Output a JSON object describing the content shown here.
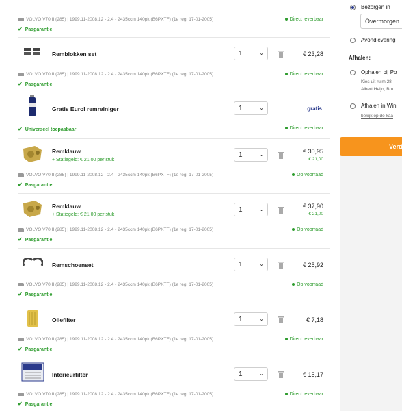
{
  "vehicle_text": "VOLVO V70 II (285) | 1999.11-2008.12 - 2.4 - 2435ccm 140pk (B6PXTF) (1e reg: 17-01-2005)",
  "guarantee_label": "Pasgarantie",
  "universal_label": "Universeel toepasbaar",
  "items": [
    {
      "name": "",
      "qty": "",
      "price": "",
      "stock": "Direct leverbaar"
    },
    {
      "name": "Remblokken set",
      "qty": "1",
      "price": "€ 23,28",
      "stock": "Direct leverbaar"
    },
    {
      "name": "Gratis Eurol remreiniger",
      "qty": "1",
      "price": "gratis",
      "stock": "Direct leverbaar"
    },
    {
      "name": "Remklauw",
      "statiegeld": "+ Statiegeld: € 21,00 per stuk",
      "qty": "1",
      "price": "€ 30,95",
      "deposit": "€ 21,00",
      "stock": "Op voorraad"
    },
    {
      "name": "Remklauw",
      "statiegeld": "+ Statiegeld: € 21,00 per stuk",
      "qty": "1",
      "price": "€ 37,90",
      "deposit": "€ 21,00",
      "stock": "Op voorraad"
    },
    {
      "name": "Remschoenset",
      "qty": "1",
      "price": "€ 25,92",
      "stock": "Op voorraad"
    },
    {
      "name": "Oliefilter",
      "qty": "1",
      "price": "€ 7,18",
      "stock": "Direct leverbaar"
    },
    {
      "name": "Interieurfilter",
      "qty": "1",
      "price": "€ 15,17",
      "stock": "Direct leverbaar"
    }
  ],
  "sidebar": {
    "option_bezorgen": "Bezorgen in",
    "select_value": "Overmorgen",
    "option_avond": "Avondlevering",
    "afhalen_title": "Afhalen:",
    "option_ophalen": "Ophalen bij Po",
    "ophalen_sub1": "Kies uit ruim 28",
    "ophalen_sub2": "Albert Heijn, Bru",
    "option_winkel": "Afhalen in Win",
    "winkel_link": "bekijk op de kaa",
    "continue_label": "Verd"
  },
  "colors": {
    "accent_green": "#2e9c2e",
    "orange": "#f7941d",
    "navy": "#2a3a8c"
  }
}
